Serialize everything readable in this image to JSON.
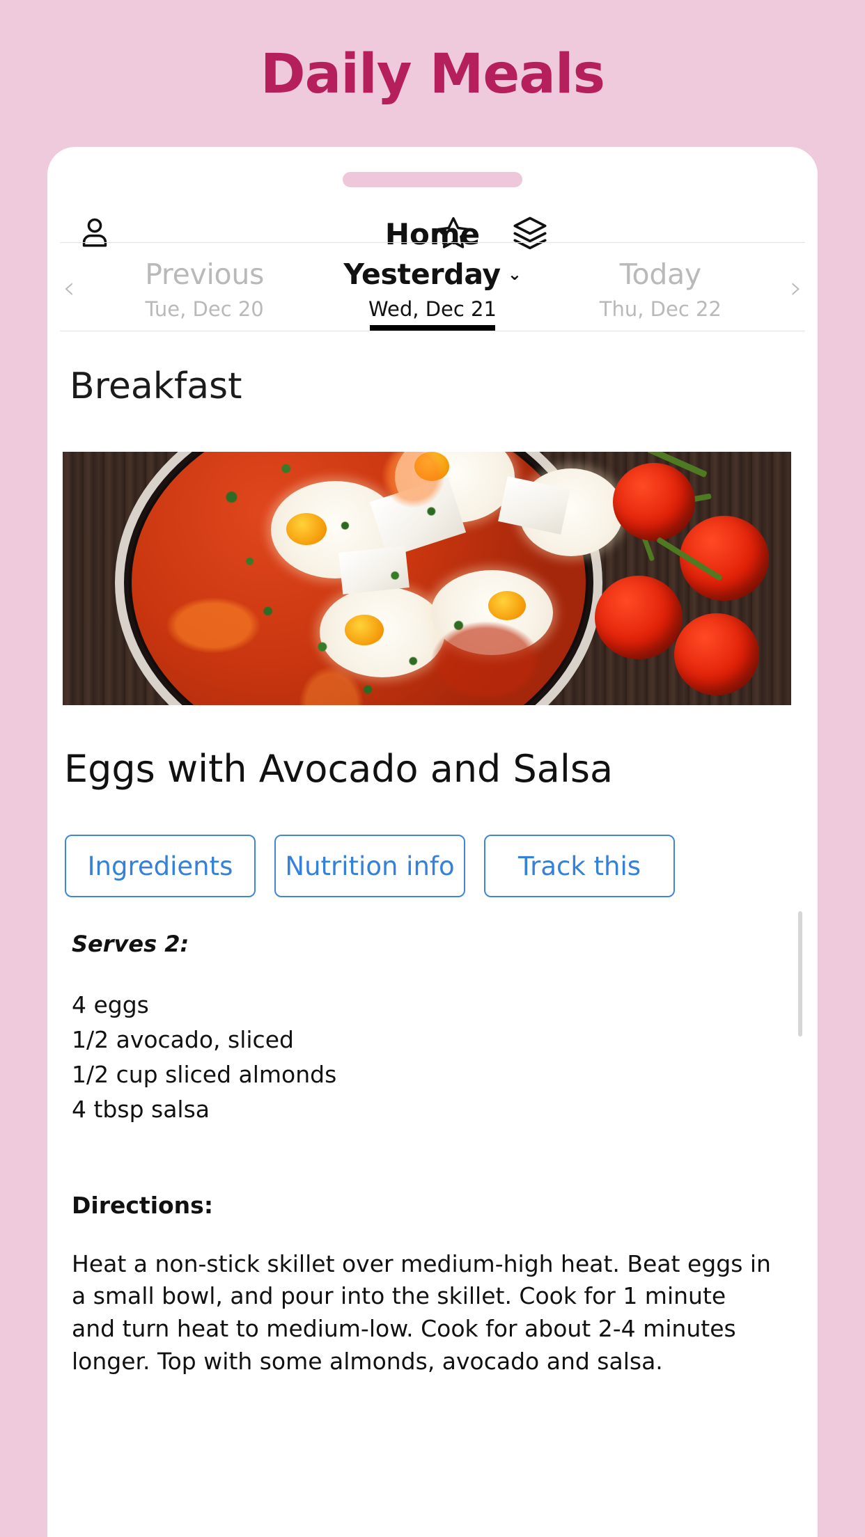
{
  "page": {
    "title": "Daily Meals",
    "title_color": "#b5205c",
    "background_color": "#efc9dc"
  },
  "navbar": {
    "title": "Home",
    "profile_icon": "person-icon",
    "star_icon": "star-icon",
    "layers_icon": "layers-icon",
    "drag_handle": "drag-handle"
  },
  "datebar": {
    "prev_arrow": "‹",
    "next_arrow": "›",
    "days": [
      {
        "label": "Previous",
        "date": "Tue, Dec 20",
        "active": false,
        "caret": ""
      },
      {
        "label": "Yesterday",
        "date": "Wed, Dec 21",
        "active": true,
        "caret": "⌄"
      },
      {
        "label": "Today",
        "date": "Thu, Dec 22",
        "active": false,
        "caret": ""
      }
    ]
  },
  "meal": {
    "section_heading": "Breakfast",
    "photo_alt": "skillet-of-eggs-in-tomato-sauce-with-tomatoes",
    "recipe_title": "Eggs with Avocado and Salsa",
    "buttons": [
      {
        "label": "Ingredients"
      },
      {
        "label": "Nutrition info"
      },
      {
        "label": "Track this"
      }
    ],
    "button_color": "#3580d8",
    "serves": "Serves 2:",
    "ingredients": [
      "4 eggs",
      "1/2 avocado, sliced",
      "1/2 cup sliced almonds",
      "4 tbsp salsa"
    ],
    "directions_heading": "Directions:",
    "directions_body": "Heat a non-stick skillet over medium-high heat. Beat eggs in a small bowl, and pour into the skillet. Cook for 1 minute and turn heat to medium-low. Cook for about 2-4 minutes longer. Top with some almonds, avocado and salsa."
  }
}
